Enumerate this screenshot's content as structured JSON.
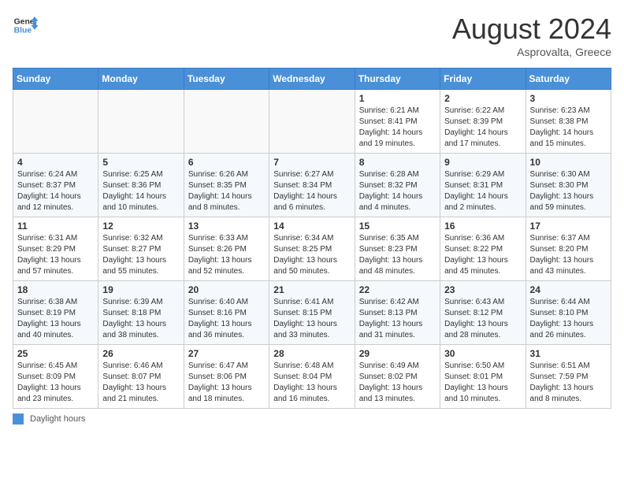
{
  "header": {
    "logo_general": "General",
    "logo_blue": "Blue",
    "month_year": "August 2024",
    "location": "Asprovalta, Greece"
  },
  "weekdays": [
    "Sunday",
    "Monday",
    "Tuesday",
    "Wednesday",
    "Thursday",
    "Friday",
    "Saturday"
  ],
  "weeks": [
    [
      {
        "day": "",
        "content": ""
      },
      {
        "day": "",
        "content": ""
      },
      {
        "day": "",
        "content": ""
      },
      {
        "day": "",
        "content": ""
      },
      {
        "day": "1",
        "content": "Sunrise: 6:21 AM\nSunset: 8:41 PM\nDaylight: 14 hours and 19 minutes."
      },
      {
        "day": "2",
        "content": "Sunrise: 6:22 AM\nSunset: 8:39 PM\nDaylight: 14 hours and 17 minutes."
      },
      {
        "day": "3",
        "content": "Sunrise: 6:23 AM\nSunset: 8:38 PM\nDaylight: 14 hours and 15 minutes."
      }
    ],
    [
      {
        "day": "4",
        "content": "Sunrise: 6:24 AM\nSunset: 8:37 PM\nDaylight: 14 hours and 12 minutes."
      },
      {
        "day": "5",
        "content": "Sunrise: 6:25 AM\nSunset: 8:36 PM\nDaylight: 14 hours and 10 minutes."
      },
      {
        "day": "6",
        "content": "Sunrise: 6:26 AM\nSunset: 8:35 PM\nDaylight: 14 hours and 8 minutes."
      },
      {
        "day": "7",
        "content": "Sunrise: 6:27 AM\nSunset: 8:34 PM\nDaylight: 14 hours and 6 minutes."
      },
      {
        "day": "8",
        "content": "Sunrise: 6:28 AM\nSunset: 8:32 PM\nDaylight: 14 hours and 4 minutes."
      },
      {
        "day": "9",
        "content": "Sunrise: 6:29 AM\nSunset: 8:31 PM\nDaylight: 14 hours and 2 minutes."
      },
      {
        "day": "10",
        "content": "Sunrise: 6:30 AM\nSunset: 8:30 PM\nDaylight: 13 hours and 59 minutes."
      }
    ],
    [
      {
        "day": "11",
        "content": "Sunrise: 6:31 AM\nSunset: 8:29 PM\nDaylight: 13 hours and 57 minutes."
      },
      {
        "day": "12",
        "content": "Sunrise: 6:32 AM\nSunset: 8:27 PM\nDaylight: 13 hours and 55 minutes."
      },
      {
        "day": "13",
        "content": "Sunrise: 6:33 AM\nSunset: 8:26 PM\nDaylight: 13 hours and 52 minutes."
      },
      {
        "day": "14",
        "content": "Sunrise: 6:34 AM\nSunset: 8:25 PM\nDaylight: 13 hours and 50 minutes."
      },
      {
        "day": "15",
        "content": "Sunrise: 6:35 AM\nSunset: 8:23 PM\nDaylight: 13 hours and 48 minutes."
      },
      {
        "day": "16",
        "content": "Sunrise: 6:36 AM\nSunset: 8:22 PM\nDaylight: 13 hours and 45 minutes."
      },
      {
        "day": "17",
        "content": "Sunrise: 6:37 AM\nSunset: 8:20 PM\nDaylight: 13 hours and 43 minutes."
      }
    ],
    [
      {
        "day": "18",
        "content": "Sunrise: 6:38 AM\nSunset: 8:19 PM\nDaylight: 13 hours and 40 minutes."
      },
      {
        "day": "19",
        "content": "Sunrise: 6:39 AM\nSunset: 8:18 PM\nDaylight: 13 hours and 38 minutes."
      },
      {
        "day": "20",
        "content": "Sunrise: 6:40 AM\nSunset: 8:16 PM\nDaylight: 13 hours and 36 minutes."
      },
      {
        "day": "21",
        "content": "Sunrise: 6:41 AM\nSunset: 8:15 PM\nDaylight: 13 hours and 33 minutes."
      },
      {
        "day": "22",
        "content": "Sunrise: 6:42 AM\nSunset: 8:13 PM\nDaylight: 13 hours and 31 minutes."
      },
      {
        "day": "23",
        "content": "Sunrise: 6:43 AM\nSunset: 8:12 PM\nDaylight: 13 hours and 28 minutes."
      },
      {
        "day": "24",
        "content": "Sunrise: 6:44 AM\nSunset: 8:10 PM\nDaylight: 13 hours and 26 minutes."
      }
    ],
    [
      {
        "day": "25",
        "content": "Sunrise: 6:45 AM\nSunset: 8:09 PM\nDaylight: 13 hours and 23 minutes."
      },
      {
        "day": "26",
        "content": "Sunrise: 6:46 AM\nSunset: 8:07 PM\nDaylight: 13 hours and 21 minutes."
      },
      {
        "day": "27",
        "content": "Sunrise: 6:47 AM\nSunset: 8:06 PM\nDaylight: 13 hours and 18 minutes."
      },
      {
        "day": "28",
        "content": "Sunrise: 6:48 AM\nSunset: 8:04 PM\nDaylight: 13 hours and 16 minutes."
      },
      {
        "day": "29",
        "content": "Sunrise: 6:49 AM\nSunset: 8:02 PM\nDaylight: 13 hours and 13 minutes."
      },
      {
        "day": "30",
        "content": "Sunrise: 6:50 AM\nSunset: 8:01 PM\nDaylight: 13 hours and 10 minutes."
      },
      {
        "day": "31",
        "content": "Sunrise: 6:51 AM\nSunset: 7:59 PM\nDaylight: 13 hours and 8 minutes."
      }
    ]
  ],
  "footer": {
    "label": "Daylight hours"
  }
}
